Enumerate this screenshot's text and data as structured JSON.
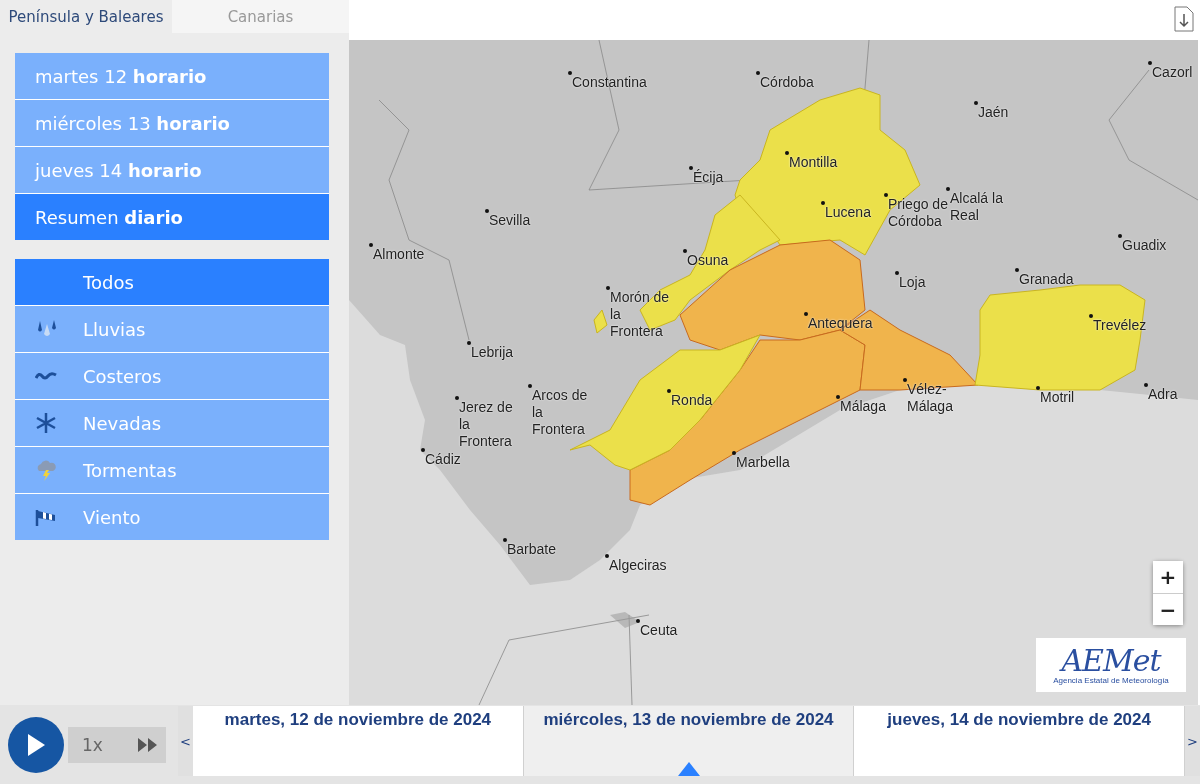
{
  "region_tabs": [
    {
      "label": "Península y Baleares",
      "selected": true
    },
    {
      "label": "Canarias",
      "selected": false
    }
  ],
  "day_menu": [
    {
      "label": "martes 12 **horario**",
      "selected": false
    },
    {
      "label": "miércoles 13 **horario**",
      "selected": false
    },
    {
      "label": "jueves 14 **horario**",
      "selected": false
    },
    {
      "label": "Resumen **diario**",
      "selected": true
    }
  ],
  "phenomena": [
    {
      "label": "Todos",
      "kind": "all",
      "selected": true
    },
    {
      "label": "Lluvias",
      "kind": "rain",
      "selected": false
    },
    {
      "label": "Costeros",
      "kind": "coast",
      "selected": false
    },
    {
      "label": "Nevadas",
      "kind": "snow",
      "selected": false
    },
    {
      "label": "Tormentas",
      "kind": "storm",
      "selected": false
    },
    {
      "label": "Viento",
      "kind": "wind",
      "selected": false
    }
  ],
  "map": {
    "cities": [
      "Constantina",
      "Córdoba",
      "Cazorl",
      "Jaén",
      "Écija",
      "Montilla",
      "Lucena",
      "Priego de Córdoba",
      "Alcalá la Real",
      "Sevilla",
      "Almonte",
      "Guadix",
      "Osuna",
      "Granada",
      "Loja",
      "Morón de la Frontera",
      "Lebrija",
      "Antequera",
      "Trevélez",
      "Arcos de la Frontera",
      "Jerez de la Frontera",
      "Ronda",
      "Vélez-Málaga",
      "Motril",
      "Adra",
      "Málaga",
      "Cádiz",
      "Marbella",
      "Barbate",
      "Algeciras",
      "Ceuta"
    ],
    "warning_zones": [
      {
        "color": "#ebe04a"
      },
      {
        "color": "#ebe04a"
      },
      {
        "color": "#ebe04a"
      },
      {
        "color": "#f0b44c"
      },
      {
        "color": "#f0b44c"
      },
      {
        "color": "#f0b44c"
      },
      {
        "color": "#ebe04a"
      },
      {
        "color": "#ebe04a"
      }
    ],
    "zoom_in": "+",
    "zoom_out": "−",
    "logo": {
      "name": "AEMet",
      "subtitle": "Agencia Estatal de Meteorología"
    }
  },
  "timeline": {
    "speed": "1x",
    "prev": "<",
    "next": ">",
    "days": [
      {
        "label": "martes, 12 de noviembre de 2024",
        "selected": false
      },
      {
        "label": "miércoles, 13 de noviembre de 2024",
        "selected": true
      },
      {
        "label": "jueves, 14 de noviembre de 2024",
        "selected": false
      }
    ]
  }
}
